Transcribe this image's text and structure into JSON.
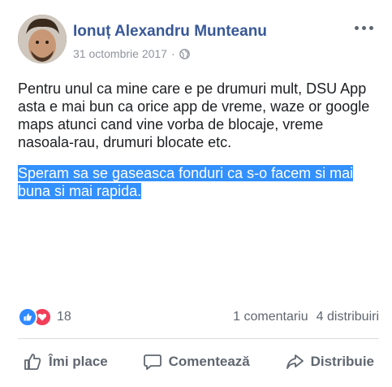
{
  "post": {
    "author": "Ionuț Alexandru Munteanu",
    "date": "31 octombrie 2017",
    "date_separator": "·",
    "privacy_icon": "globe-icon",
    "paragraphs": [
      "Pentru unul ca mine care e pe drumuri mult, DSU App asta e mai bun ca orice app de vreme, waze or google maps atunci cand vine vorba de blocaje, vreme nasoala-rau, drumuri blocate etc.",
      "Speram sa se gaseasca fonduri ca s-o facem si mai buna si mai rapida."
    ],
    "highlighted_paragraph_index": 1
  },
  "stats": {
    "reactions": [
      "like-icon",
      "love-icon"
    ],
    "reaction_count": "18",
    "comments": "1 comentariu",
    "shares": "4 distribuiri"
  },
  "actions": {
    "like_label": "Îmi place",
    "comment_label": "Comentează",
    "share_label": "Distribuie"
  },
  "colors": {
    "author": "#385898",
    "selection": "#3390ff",
    "like": "#2e89ff",
    "love": "#f33e58",
    "muted": "#606770"
  }
}
